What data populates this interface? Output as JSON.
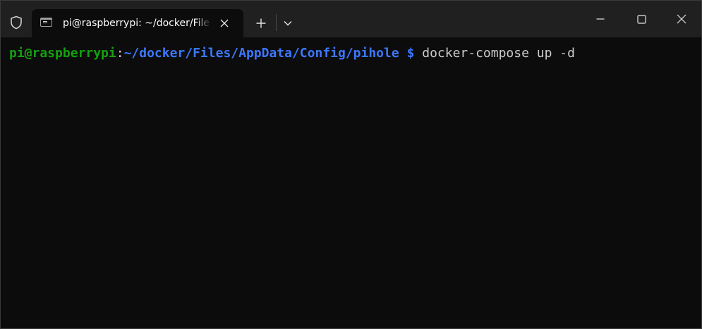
{
  "tabs": [
    {
      "title": "pi@raspberrypi: ~/docker/Files/AppData/Config/pihole",
      "active": true
    }
  ],
  "titlebar": {
    "shield_icon": "shield-icon",
    "new_tab_icon": "plus-icon",
    "dropdown_icon": "chevron-down-icon",
    "minimize_icon": "minimize-icon",
    "maximize_icon": "maximize-icon",
    "close_icon": "close-icon"
  },
  "terminal": {
    "prompt_user": "pi@raspberrypi",
    "prompt_separator": ":",
    "prompt_path": "~/docker/Files/AppData/Config/pihole",
    "prompt_symbol": " $",
    "command": " docker-compose up -d"
  },
  "colors": {
    "background": "#0c0c0c",
    "titlebar": "#202020",
    "user_green": "#13a10e",
    "path_blue": "#3b78ff",
    "text": "#cccccc"
  }
}
